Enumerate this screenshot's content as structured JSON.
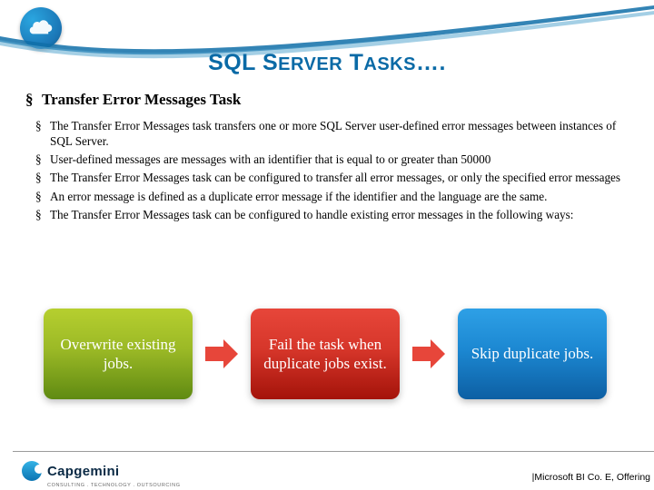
{
  "title_main": "SQL S",
  "title_rest1": "ERVER",
  "title_mid": " T",
  "title_rest2": "ASKS",
  "title_tail": "….",
  "subhead": "Transfer Error Messages Task",
  "bullets": [
    "The Transfer Error Messages task transfers one or more SQL Server user-defined error messages between instances of SQL Server.",
    "User-defined messages are messages with an identifier that is equal to or greater than 50000",
    " The Transfer Error Messages task can be configured to transfer all error messages, or only the specified error messages",
    "An error message is defined as a duplicate error message if the identifier and the language are the same.",
    "The Transfer Error Messages task can be configured to handle existing error messages in the following ways:"
  ],
  "cards": {
    "c1": "Overwrite existing jobs.",
    "c2": "Fail the task when duplicate jobs exist.",
    "c3": "Skip duplicate jobs."
  },
  "logo_text": "Capgemini",
  "logo_sub": "CONSULTING . TECHNOLOGY . OUTSOURCING",
  "footer_right": "|Microsoft BI Co. E, Offering"
}
